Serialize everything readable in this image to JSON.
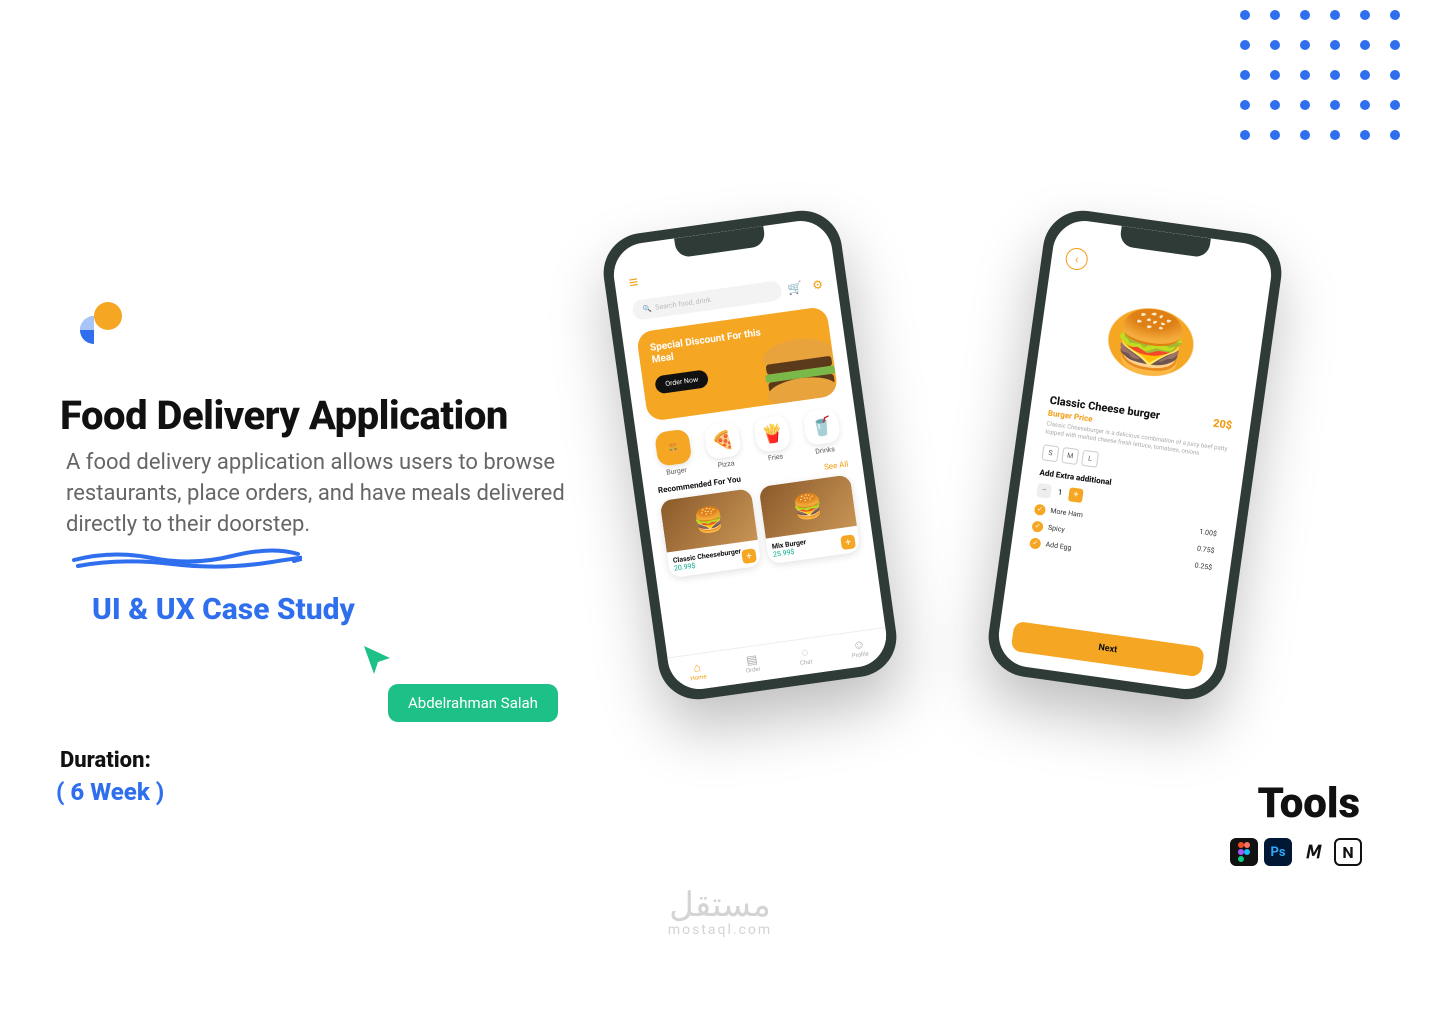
{
  "title": "Food Delivery Application",
  "description": "A food delivery application allows users to browse restaurants, place orders, and have meals delivered directly to their doorstep.",
  "subtitle": "UI & UX Case Study",
  "author_tag": "Abdelrahman Salah",
  "duration": {
    "label": "Duration:",
    "value": "( 6 Week )"
  },
  "tools": {
    "label": "Tools",
    "items": [
      "Figma",
      "Photoshop",
      "Miro",
      "Notion"
    ]
  },
  "watermark": {
    "arabic": "مستقل",
    "latin": "mostaql.com"
  },
  "phone_left": {
    "search_placeholder": "Search food, drink",
    "banner_title": "Special Discount For this Meal",
    "banner_cta": "Order Now",
    "categories": [
      "Burger",
      "Pizza",
      "Fries",
      "Drinks"
    ],
    "recommended_label": "Recommended For You",
    "see_all": "See All",
    "cards": [
      {
        "name": "Classic Cheeseburger",
        "price": "20.99$"
      },
      {
        "name": "Mix Burger",
        "price": "25.99$"
      }
    ],
    "nav": [
      "Home",
      "Order",
      "Chat",
      "Profile"
    ]
  },
  "phone_right": {
    "product_name": "Classic Cheese burger",
    "price": "20$",
    "subtitle": "Burger Price",
    "description": "Classic Cheeseburger is a delicious combination of a juicy beef patty topped with melted cheese fresh lettuce, tomatoes, onions",
    "sizes": [
      "S",
      "M",
      "L"
    ],
    "extra_heading": "Add Extra additional",
    "quantity": "1",
    "options": [
      {
        "label": "More Ham",
        "price": "1.00$"
      },
      {
        "label": "Spicy",
        "price": "0.75$"
      },
      {
        "label": "Add Egg",
        "price": "0.25$"
      }
    ],
    "cta": "Next"
  }
}
